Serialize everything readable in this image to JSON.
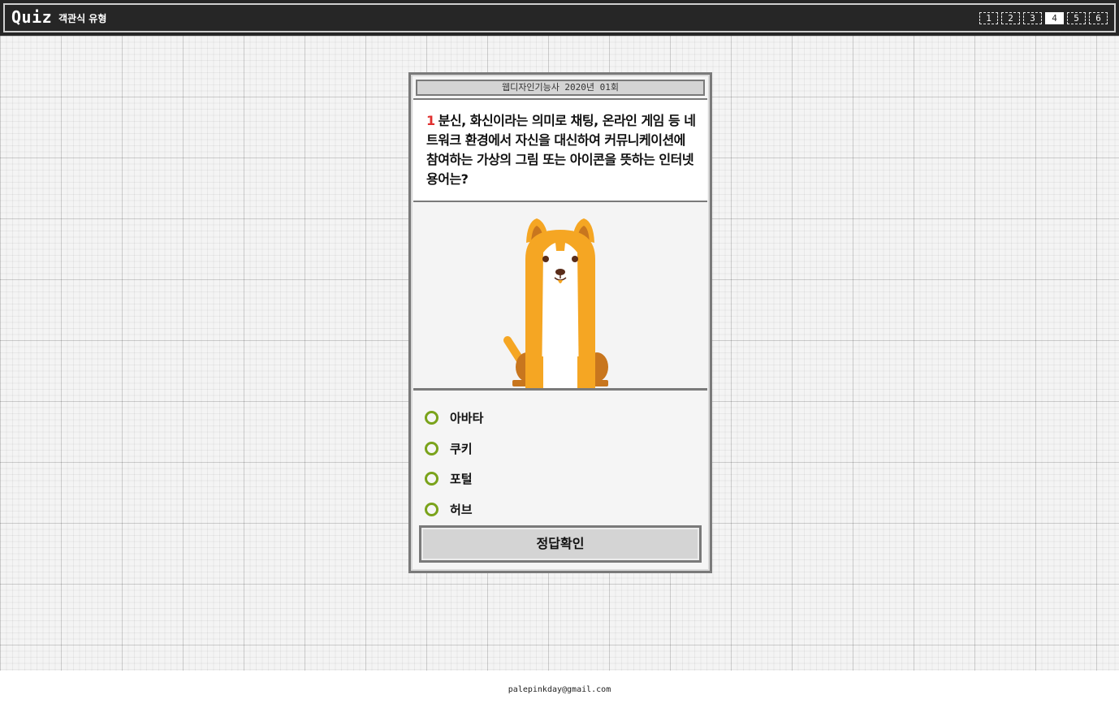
{
  "header": {
    "logo": "Quiz",
    "subtitle": "객관식 유형",
    "pages": [
      "1",
      "2",
      "3",
      "4",
      "5",
      "6"
    ],
    "active_page": "4"
  },
  "quiz": {
    "title": "웹디자인기능사 2020년 01회",
    "question_number": "1",
    "question_text": "분신, 화신이라는 의미로 채팅, 온라인 게임 등 네트워크 환경에서 자신을 대신하여 커뮤니케이션에 참여하는 가상의 그림 또는 아이콘을 뜻하는 인터넷 용어는?",
    "image_icon": "dog-illustration",
    "options": [
      {
        "label": "아바타"
      },
      {
        "label": "쿠키"
      },
      {
        "label": "포털"
      },
      {
        "label": "허브"
      }
    ],
    "submit_label": "정답확인"
  },
  "footer": {
    "email": "palepinkday@gmail.com"
  },
  "colors": {
    "header_bg": "#262626",
    "accent_red": "#e0302f",
    "radio_green": "#7aa31b",
    "dog_orange": "#f5a623"
  }
}
